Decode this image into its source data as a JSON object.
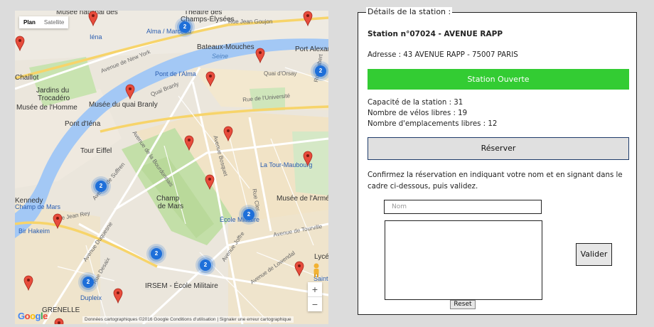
{
  "map": {
    "maptype": {
      "plan": "Plan",
      "satellite": "Satellite"
    },
    "labels": [
      {
        "text": "Musée national des",
        "cls": "dark"
      },
      {
        "text": "Théâtre des",
        "cls": "dark"
      },
      {
        "text": "Champs-Élysées",
        "cls": "dark"
      },
      {
        "text": "Alma / Marceau",
        "cls": "blue"
      },
      {
        "text": "Rue Jean Goujon",
        "cls": "street"
      },
      {
        "text": "Bateaux-Mouches",
        "cls": "dark"
      },
      {
        "text": "Seine",
        "cls": "water"
      },
      {
        "text": "Port Alexandre",
        "cls": "dark"
      },
      {
        "text": "Chaillot",
        "cls": "dark"
      },
      {
        "text": "Jardins du",
        "cls": "dark"
      },
      {
        "text": "Trocadéro",
        "cls": "dark"
      },
      {
        "text": "Avenue de New York",
        "cls": "street"
      },
      {
        "text": "Pont de l'Alma",
        "cls": "blue"
      },
      {
        "text": "Quai d'Orsay",
        "cls": "street"
      },
      {
        "text": "Musée de l'Homme",
        "cls": "dark"
      },
      {
        "text": "Musée du quai Branly",
        "cls": "dark"
      },
      {
        "text": "Quai Branly",
        "cls": "street"
      },
      {
        "text": "Rue de l'Université",
        "cls": "street"
      },
      {
        "text": "Pont d'Iéna",
        "cls": "dark"
      },
      {
        "text": "Tour Eiffel",
        "cls": "dark"
      },
      {
        "text": "Avenue de la Bourdonnais",
        "cls": "street"
      },
      {
        "text": "Avenue Bosquet",
        "cls": "street"
      },
      {
        "text": "La Tour-Maubourg",
        "cls": "blue"
      },
      {
        "text": "Champ",
        "cls": "dark"
      },
      {
        "text": "de Mars",
        "cls": "dark"
      },
      {
        "text": "Rue Cler",
        "cls": "street"
      },
      {
        "text": "Musée de l'Armée",
        "cls": "dark"
      },
      {
        "text": "Kennedy",
        "cls": "dark"
      },
      {
        "text": "Champ de Mars",
        "cls": "blue"
      },
      {
        "text": "Rue Jean Rey",
        "cls": "street"
      },
      {
        "text": "École Militaire",
        "cls": "blue"
      },
      {
        "text": "Avenue de Suffren",
        "cls": "street"
      },
      {
        "text": "Bir Hakeim",
        "cls": "blue"
      },
      {
        "text": "Avenue de Tourville",
        "cls": "street"
      },
      {
        "text": "Avenue Duquesne",
        "cls": "street"
      },
      {
        "text": "Avenue de Lowendal",
        "cls": "street"
      },
      {
        "text": "Rue Desaix",
        "cls": "street"
      },
      {
        "text": "IRSEM - École Militaire",
        "cls": "dark"
      },
      {
        "text": "Dupleix",
        "cls": "blue"
      },
      {
        "text": "Lycée",
        "cls": "dark"
      },
      {
        "text": "Saint-François",
        "cls": "blue"
      },
      {
        "text": "GRENELLE",
        "cls": "dark"
      },
      {
        "text": "Avenue Joffre",
        "cls": "street"
      },
      {
        "text": "Rue Fabert",
        "cls": "street"
      },
      {
        "text": "Iéna",
        "cls": "blue"
      }
    ],
    "clusters": [
      "2",
      "2",
      "2",
      "2",
      "2",
      "2",
      "2"
    ],
    "zoom_in": "+",
    "zoom_out": "−",
    "google": "Google",
    "attribution": "Données cartographiques ©2016 Google    Conditions d'utilisation  |  Signaler une erreur cartographique",
    "colors": {
      "water": "#a3c8f5",
      "marker": "#e74c3c",
      "cluster": "#1e6fd9"
    }
  },
  "panel": {
    "legend": "Détails de la station :",
    "station_title": "Station n°07024 - AVENUE RAPP",
    "address": "Adresse : 43 AVENUE RAPP - 75007 PARIS",
    "status": "Station Ouverte",
    "status_color": "#33cc33",
    "capacity": "Capacité de la station : 31",
    "bikes": "Nombre de vélos libres : 19",
    "slots": "Nombre d'emplacements libres : 12",
    "reserve_label": "Réserver",
    "instructions_line1": "Confirmez la réservation en indiquant votre nom et en signant dans le",
    "instructions_line2": "cadre ci-dessous, puis validez.",
    "name_placeholder": "Nom",
    "reset_label": "Reset",
    "validate_label": "Valider"
  }
}
